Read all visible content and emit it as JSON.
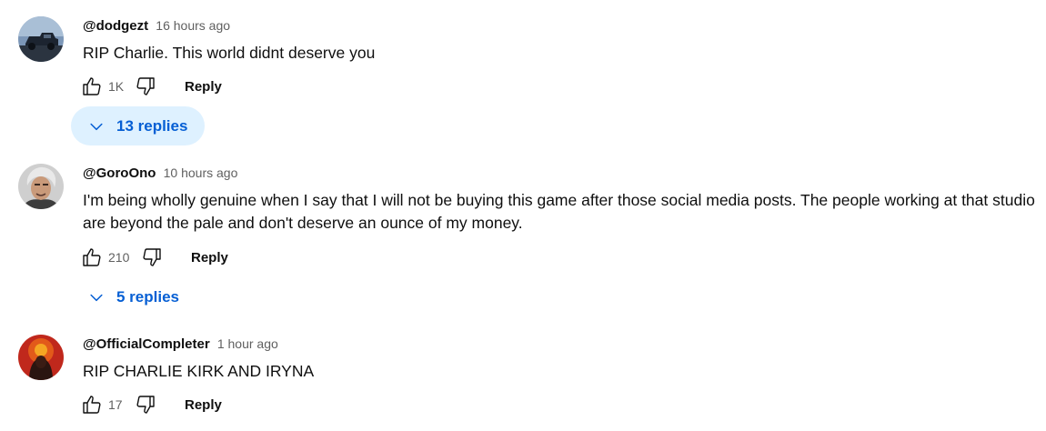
{
  "comments": [
    {
      "author": "@dodgezt",
      "time": "16 hours ago",
      "text": "RIP Charlie. This world didnt deserve you",
      "likes": "1K",
      "reply_label": "Reply",
      "replies_label": "13 replies",
      "replies_highlighted": true,
      "avatar": "truck-avatar"
    },
    {
      "author": "@GoroOno",
      "time": "10 hours ago",
      "text_lines": [
        "I'm being wholly genuine when I say that I will not be buying this game after those social media posts. The people working at that studio",
        "are beyond the pale and don't deserve an ounce of my money."
      ],
      "likes": "210",
      "reply_label": "Reply",
      "replies_label": "5 replies",
      "replies_highlighted": false,
      "avatar": "person-avatar"
    },
    {
      "author": "@OfficialCompleter",
      "time": "1 hour ago",
      "text": "RIP CHARLIE KIRK AND IRYNA",
      "likes": "17",
      "reply_label": "Reply",
      "avatar": "hooded-figure-avatar"
    }
  ],
  "colors": {
    "text": "#0f0f0f",
    "secondary": "#606060",
    "link": "#065fd4",
    "replies_bg": "#def1ff"
  },
  "icons": [
    "like-icon",
    "dislike-icon",
    "chevron-down-icon"
  ]
}
